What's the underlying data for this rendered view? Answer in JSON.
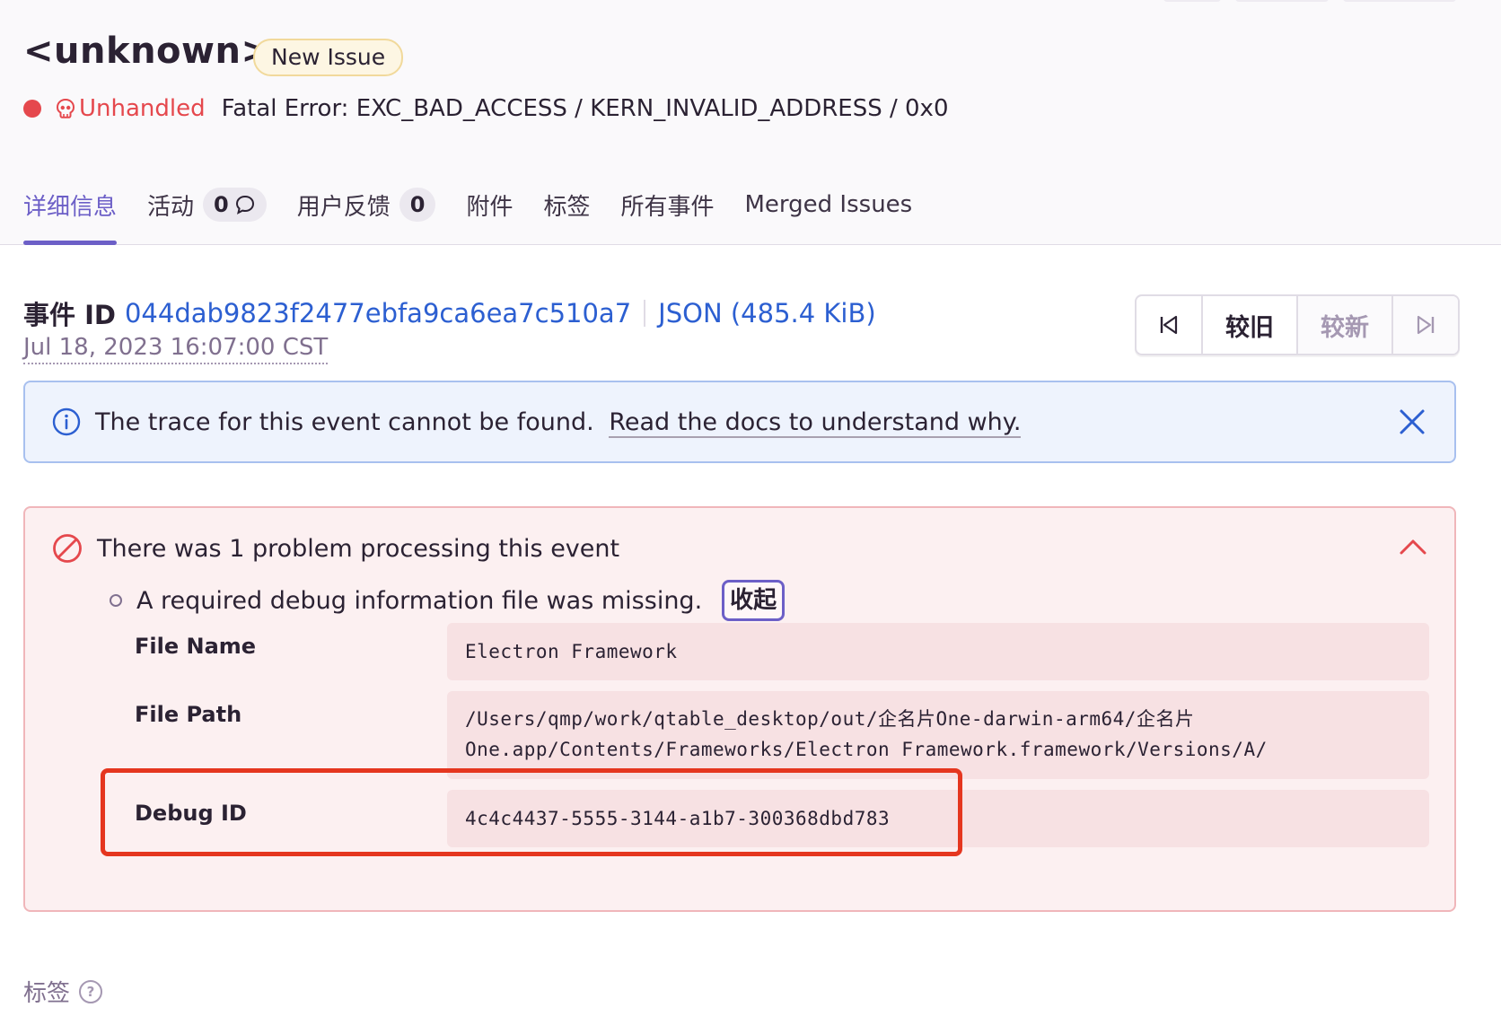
{
  "issue": {
    "title": "<unknown>",
    "badge": "New Issue",
    "status": "Unhandled",
    "error_message": "Fatal Error: EXC_BAD_ACCESS / KERN_INVALID_ADDRESS / 0x0"
  },
  "tabs": [
    {
      "label": "详细信息"
    },
    {
      "label": "活动",
      "count": "0"
    },
    {
      "label": "用户反馈",
      "count": "0"
    },
    {
      "label": "附件"
    },
    {
      "label": "标签"
    },
    {
      "label": "所有事件"
    },
    {
      "label": "Merged Issues"
    }
  ],
  "event": {
    "id_label": "事件 ID",
    "id": "044dab9823f2477ebfa9ca6ea7c510a7",
    "json_link": "JSON (485.4 KiB)",
    "timestamp": "Jul 18, 2023 16:07:00 CST"
  },
  "navigation": {
    "older": "较旧",
    "newer": "较新"
  },
  "trace_alert": {
    "message": "The trace for this event cannot be found.",
    "link": "Read the docs to understand why."
  },
  "problem_alert": {
    "heading": "There was 1 problem processing this event",
    "item": "A required debug information file was missing.",
    "collapse_label": "收起",
    "details": [
      {
        "label": "File Name",
        "value": "Electron Framework"
      },
      {
        "label": "File Path",
        "value_line1": "/Users/qmp/work/qtable_desktop/out/企名片One-darwin-arm64/企名片",
        "value_line2": "One.app/Contents/Frameworks/Electron Framework.framework/Versions/A/"
      },
      {
        "label": "Debug ID",
        "value": "4c4c4437-5555-3144-a1b7-300368dbd783"
      }
    ]
  },
  "tags_section": {
    "heading": "标签"
  },
  "colors": {
    "accent": "#6c5fc7",
    "error": "#e5484d",
    "link": "#2c5fd1",
    "highlight_box": "#e5361f"
  }
}
